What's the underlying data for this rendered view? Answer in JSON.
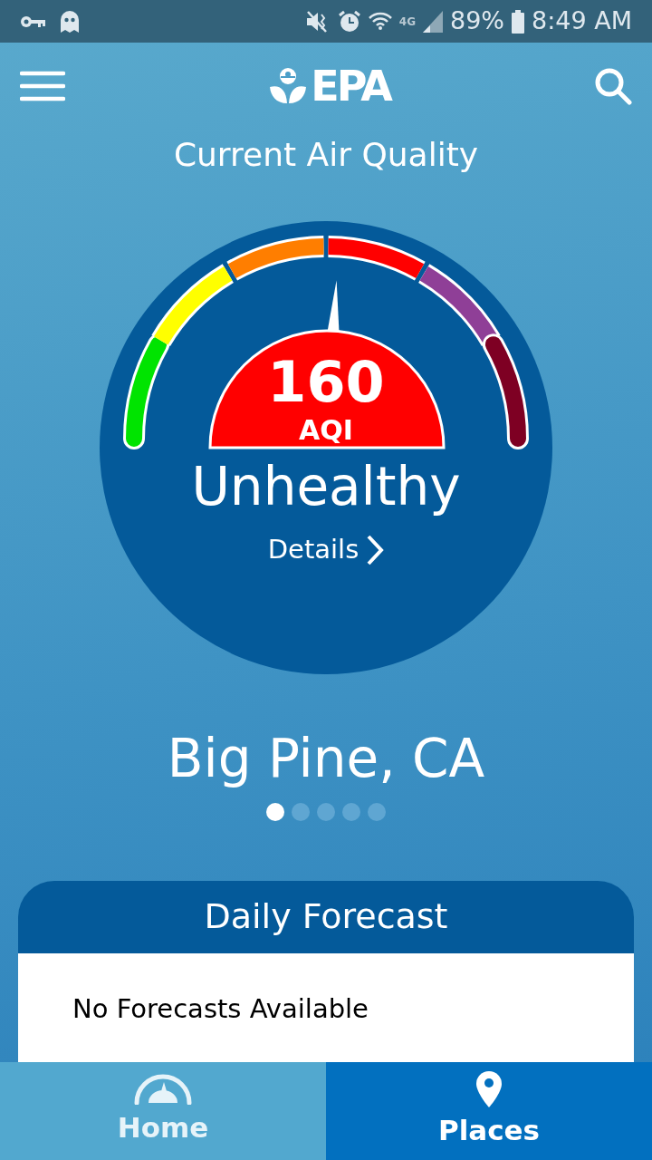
{
  "status_bar": {
    "network": "4G",
    "battery": "89%",
    "time": "8:49 AM"
  },
  "header": {
    "logo": "EPA"
  },
  "title": "Current Air Quality",
  "gauge": {
    "value": "160",
    "unit": "AQI",
    "category": "Unhealthy",
    "color": "#ff0000",
    "details": "Details",
    "segments": [
      {
        "color": "#00e400"
      },
      {
        "color": "#ffff00"
      },
      {
        "color": "#ff7e00"
      },
      {
        "color": "#ff0000"
      },
      {
        "color": "#8f3f97"
      },
      {
        "color": "#7e0023"
      }
    ]
  },
  "location": "Big Pine, CA",
  "pager": [
    {
      "selected": true
    },
    {
      "selected": false
    },
    {
      "selected": false
    },
    {
      "selected": false
    },
    {
      "selected": false
    }
  ],
  "forecast": {
    "title": "Daily Forecast",
    "message": "No Forecasts Available"
  },
  "tabs": [
    {
      "label": "Home",
      "kind": "home",
      "selected": true
    },
    {
      "label": "Places",
      "kind": "places",
      "selected": false
    }
  ]
}
